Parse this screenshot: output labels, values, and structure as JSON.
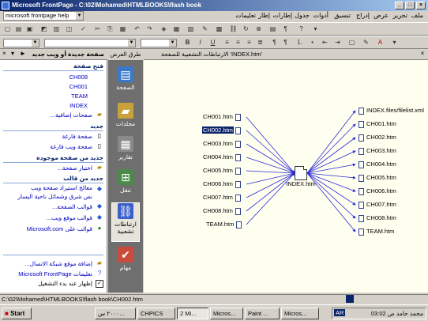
{
  "window": {
    "title": "Microsoft FrontPage - C:\\02\\Mohamed\\HTMLBOOKS\\flash book"
  },
  "menubar": {
    "help_box": "microsoft frontpage help",
    "items": [
      "ملف",
      "تحرير",
      "عرض",
      "إدراج",
      "تنسيق",
      "أدوات",
      "جدول",
      "إطارات",
      "إطار",
      "تعليمات"
    ]
  },
  "taskpane": {
    "title": "صفحة جديدة أو ويب جديد",
    "section_open": "فتح صفحة",
    "open_items": [
      "CH008",
      "CH001",
      "TEAM",
      "INDEX"
    ],
    "more_pages": "صفحات إضافية...",
    "section_new": "جديد",
    "new_items": [
      "صفحة فارغة",
      "صفحة ويب فارغة"
    ],
    "section_existing": "جديد من صفحة موجودة",
    "choose_page": "اختيار صفحة...",
    "section_template": "جديد من قالب",
    "template_note_1": "معالج استيراد صفحة ويب",
    "template_note_2": "نص شرق وشمائل ناحية اليسار",
    "template_items": [
      "قوالب الصفحة...",
      "قوالب موقع ويب...",
      "قوالب على Microsoft.com"
    ],
    "footer_items": [
      "إضافة موقع شبكة الاتصال...",
      "تعليمات Microsoft FrontPage",
      "إظهار عند بدء التشغيل"
    ]
  },
  "views": {
    "header": "طرق العرض",
    "items": [
      "الصفحة",
      "مجلدات",
      "تقارير",
      "تنقل",
      "ارتباطات تشعبية",
      "مهام"
    ]
  },
  "doc": {
    "tab_title": "الارتباطات التشعبية للصفحة 'INDEX.htm'",
    "center": "INDEX.htm",
    "left_nodes": [
      "CH001.htm",
      "CH002.htm",
      "CH003.htm",
      "CH004.htm",
      "CH005.htm",
      "CH006.htm",
      "CH007.htm",
      "CH008.htm",
      "TEAM.htm"
    ],
    "selected": "CH002.htm",
    "right_nodes": [
      "INDEX.files/filelist.xml",
      "CH001.htm",
      "CH002.htm",
      "CH003.htm",
      "CH004.htm",
      "CH005.htm",
      "CH006.htm",
      "CH007.htm",
      "CH008.htm",
      "TEAM.htm"
    ],
    "line_color": "#2b2bd8"
  },
  "status": {
    "path": "C:\\02\\Mohamed\\HTMLBOOKS\\flash book\\CH002.htm"
  },
  "taskbar": {
    "start": "Start",
    "buttons": [
      "٢٠٠٠ س...",
      "CHPICS",
      "2 Mi...",
      "Micros...",
      "Paint ...",
      "Micros..."
    ],
    "tray_lang": "AR",
    "clock": "محمد حامد ص 03:02"
  },
  "colors": {
    "titlebar": "#0a246a",
    "doc_bg": "#fffff0",
    "views_bg": "#6f6f6f",
    "selection": "#0a246a"
  }
}
